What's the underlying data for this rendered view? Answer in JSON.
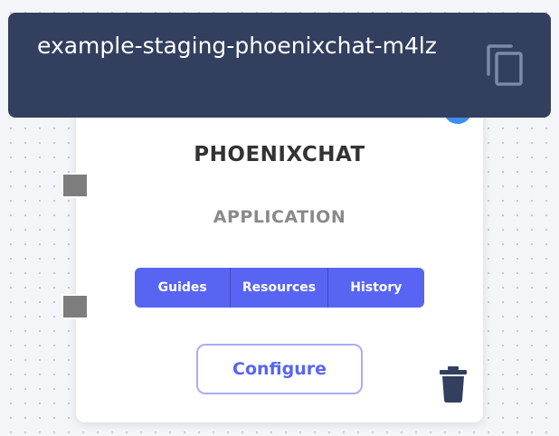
{
  "node": {
    "title": "PHOENIXCHAT",
    "type_label": "APPLICATION",
    "tabs": [
      {
        "label": "Guides"
      },
      {
        "label": "Resources"
      },
      {
        "label": "History"
      }
    ],
    "configure_label": "Configure",
    "status_color": "#3b8ef0",
    "icons": [
      "trash-icon"
    ]
  },
  "tooltip": {
    "text": "example-staging-phoenixchat-m4lz",
    "icons": [
      "copy-icon"
    ]
  },
  "colors": {
    "accent": "#5865f2",
    "tooltip_bg": "#323f5e",
    "port": "#7d7d7d"
  }
}
